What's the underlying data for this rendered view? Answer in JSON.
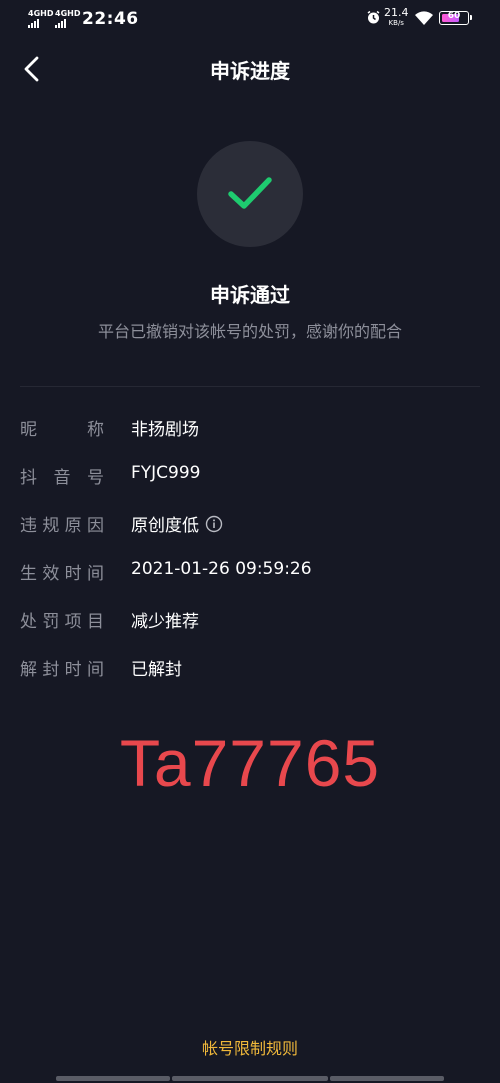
{
  "status_bar": {
    "network_1": "4GHD",
    "network_2": "4GHD",
    "time": "22:46",
    "speed_value": "21.4",
    "speed_unit": "KB/s",
    "battery_level": "60"
  },
  "header": {
    "title": "申诉进度",
    "back_icon": "chevron-left-icon"
  },
  "result": {
    "icon": "checkmark-icon",
    "title": "申诉通过",
    "description": "平台已撤销对该帐号的处罚，感谢你的配合",
    "accent_color": "#1ecb6f"
  },
  "details": [
    {
      "label": "昵称",
      "value": "非扬剧场"
    },
    {
      "label": "抖音号",
      "value": "FYJC999"
    },
    {
      "label": "违规原因",
      "value": "原创度低"
    },
    {
      "label": "生效时间",
      "value": "2021-01-26 09:59:26"
    },
    {
      "label": "处罚项目",
      "value": "减少推荐"
    },
    {
      "label": "解封时间",
      "value": "已解封"
    }
  ],
  "watermark": "Ta77765",
  "footer": {
    "rules_link": "帐号限制规则",
    "link_color": "#f0b83a"
  }
}
